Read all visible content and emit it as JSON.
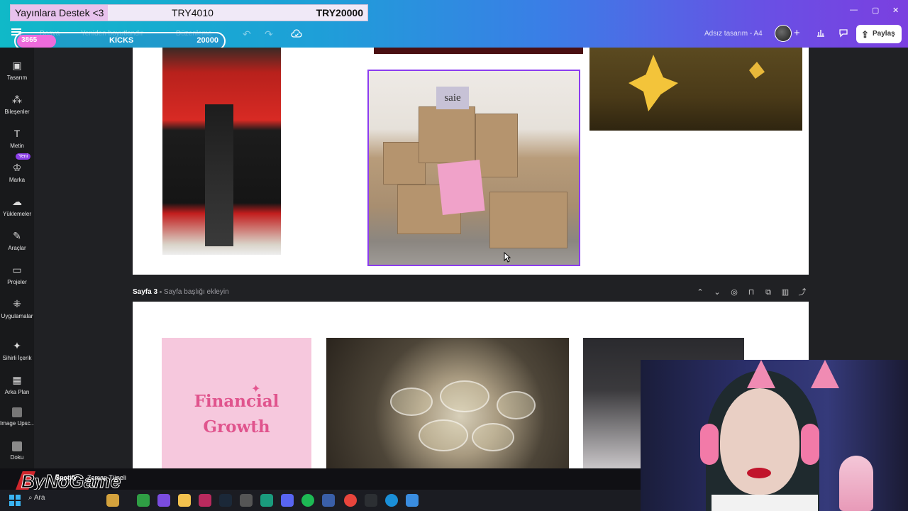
{
  "window": {
    "minimize": "—",
    "maximize": "▢",
    "close": "✕"
  },
  "overlay": {
    "donation_label": "Yayınlara Destek <3",
    "donation_current": "TRY4010",
    "donation_goal": "TRY20000",
    "kicks_count": "3865",
    "kicks_label": "KICKS",
    "kicks_goal": "20000",
    "kicks_progress": 0.19
  },
  "toolbar": {
    "file_label": "Dosya",
    "resize_label": "Yeniden boyutlandır",
    "edit_label": "Düzenleme",
    "design_title": "Adsız tasarım - A4",
    "share_label": "Paylaş"
  },
  "sidebar": {
    "items": [
      {
        "label": "Tasarım",
        "icon": "template-icon"
      },
      {
        "label": "Bileşenler",
        "icon": "elements-icon"
      },
      {
        "label": "Metin",
        "icon": "text-icon"
      },
      {
        "label": "Marka",
        "icon": "brand-icon"
      },
      {
        "label": "Yüklemeler",
        "icon": "upload-icon"
      },
      {
        "label": "Araçlar",
        "icon": "draw-icon"
      },
      {
        "label": "Projeler",
        "icon": "folder-icon"
      },
      {
        "label": "Uygulamalar",
        "icon": "apps-icon"
      },
      {
        "label": "Sihirli İçerik",
        "icon": "magic-icon"
      },
      {
        "label": "Arka Plan",
        "icon": "background-icon"
      },
      {
        "label": "Image Upsc...",
        "icon": "upscale-icon"
      },
      {
        "label": "Doku",
        "icon": "texture-icon"
      }
    ],
    "new_badge": "Yeni"
  },
  "page2": {
    "box_tag": "saie"
  },
  "page3": {
    "title": "Sayfa 3 -",
    "subtitle": "Sayfa başlığı ekleyin",
    "card_line1": "Financial",
    "card_line2": "Growth"
  },
  "stream": {
    "logo": "ByNoGame",
    "spotify_prefix": "Spotify",
    "spotify_text": "Zaman Tüneli"
  },
  "taskbar": {
    "search_label": "Ara"
  },
  "colors": {
    "accent": "#8b3cf0",
    "card_pink": "#f6c8dd",
    "card_text": "#e0548d"
  }
}
